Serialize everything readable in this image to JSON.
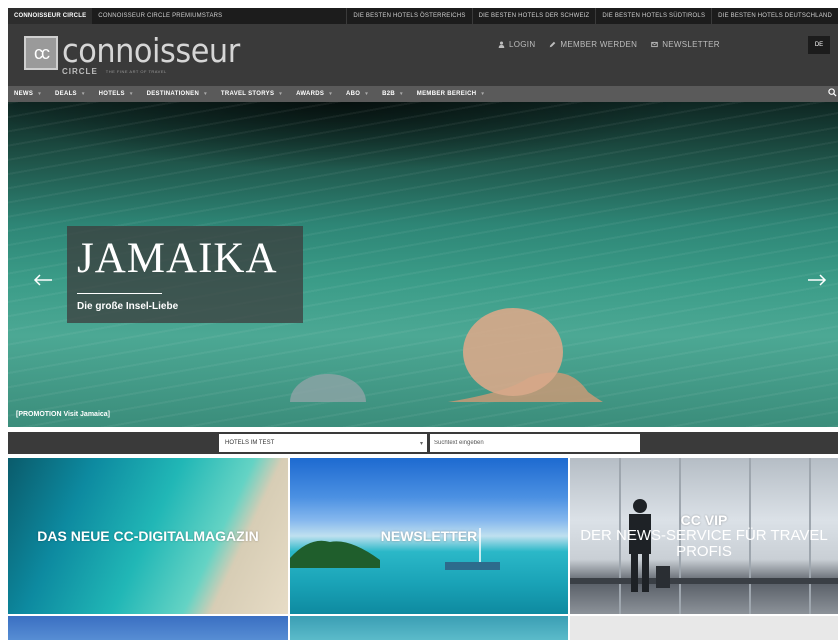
{
  "topbar": {
    "left": [
      "Connoisseur Circle",
      "Connoisseur Circle Premiumstars"
    ],
    "right": [
      "Die besten Hotels Österreichs",
      "Die besten Hotels der Schweiz",
      "Die besten Hotels Südtirols",
      "Die besten Hotels Deutschland"
    ]
  },
  "header": {
    "logo_mark": "cc",
    "logo_main": "connoisseur",
    "logo_circle": "CIRCLE",
    "logo_tagline": "THE FINE ART OF TRAVEL",
    "login": "Login",
    "member": "Member werden",
    "newsletter": "Newsletter",
    "language": "DE"
  },
  "nav": [
    "News",
    "Deals",
    "Hotels",
    "Destinationen",
    "Travel Storys",
    "Awards",
    "Abo",
    "B2B",
    "Member Bereich"
  ],
  "hero": {
    "title": "JAMAIKA",
    "subtitle": "Die große Insel-Liebe",
    "promo": "[PROMOTION Visit Jamaica]"
  },
  "search": {
    "select_value": "Hotels im Test",
    "placeholder": "Suchtext eingeben"
  },
  "tiles": {
    "magazin": "Das neue CC-Digitalmagazin",
    "newsletter": "Newsletter",
    "vip_title": "CC VIP",
    "vip_sub": "Der News-Service für Travel Profis"
  },
  "icons": {
    "login": "user-icon",
    "member": "pen-icon",
    "newsletter": "mail-icon",
    "search": "search-icon",
    "prev": "arrow-left-icon",
    "next": "arrow-right-icon"
  },
  "colors": {
    "topbar": "#1c1c1c",
    "header": "#3a3a3a",
    "nav": "#5a5a5a"
  }
}
